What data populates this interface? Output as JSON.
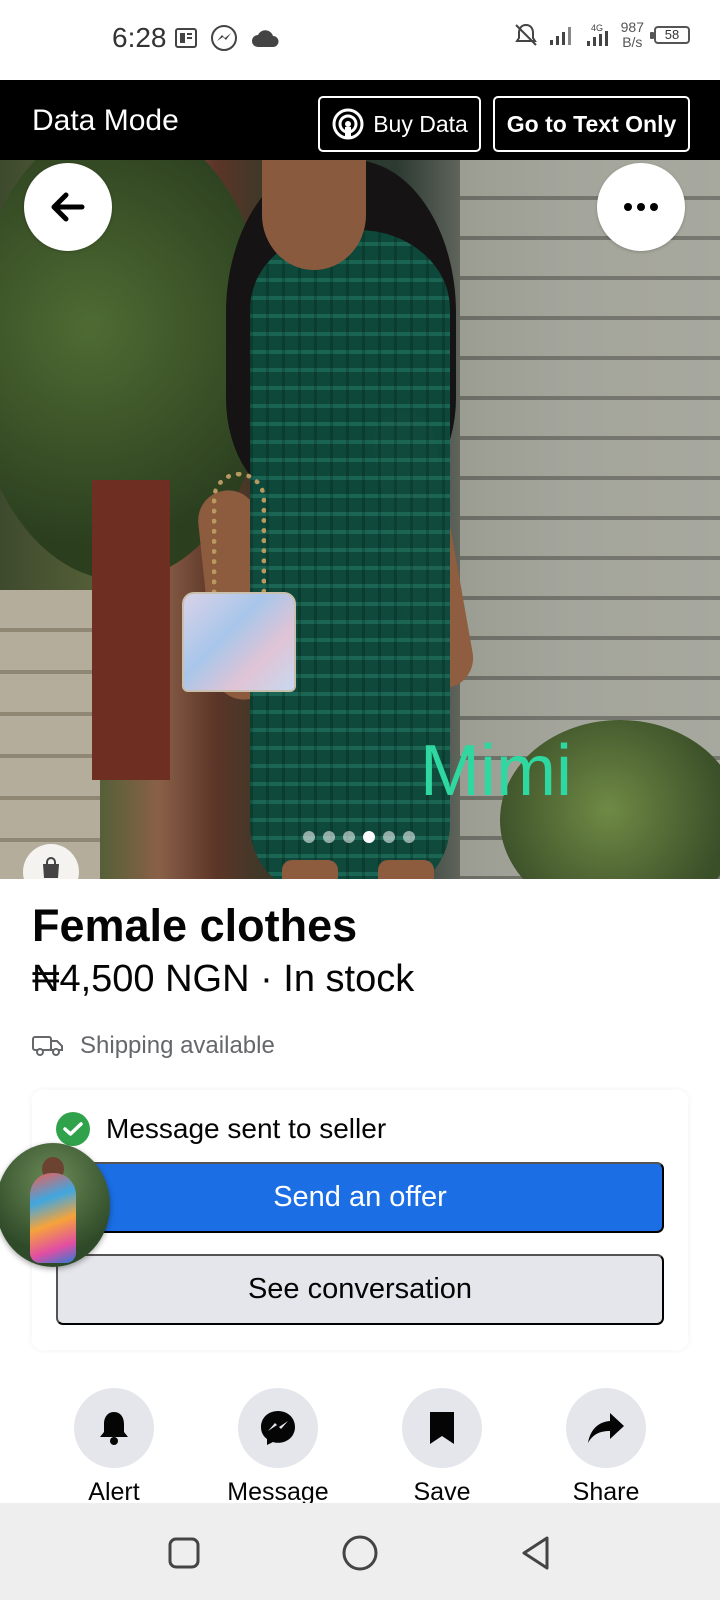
{
  "status_bar": {
    "time": "6:28",
    "network_type": "4G",
    "net_speed_value": "987",
    "net_speed_unit": "B/s",
    "battery_level": "58"
  },
  "data_mode_bar": {
    "title": "Data Mode",
    "buy_data_label": "Buy Data",
    "text_only_label": "Go to Text Only"
  },
  "hero": {
    "watermark": "Mimi",
    "image_count": 6,
    "active_index": 4
  },
  "product": {
    "title": "Female clothes",
    "price_line": "₦4,500 NGN · In stock",
    "shipping": "Shipping available"
  },
  "seller_card": {
    "sent_message": "Message sent to seller",
    "send_offer_label": "Send an offer",
    "see_conversation_label": "See conversation"
  },
  "actions": [
    {
      "label": "Alert",
      "icon": "bell-icon"
    },
    {
      "label": "Message",
      "icon": "messenger-icon"
    },
    {
      "label": "Save",
      "icon": "bookmark-icon"
    },
    {
      "label": "Share",
      "icon": "share-arrow-icon"
    }
  ],
  "colors": {
    "primary_blue": "#1b6ee4",
    "secondary_gray": "#e4e6eb",
    "success_green": "#31a24c",
    "watermark_green": "#2fd8a0"
  }
}
